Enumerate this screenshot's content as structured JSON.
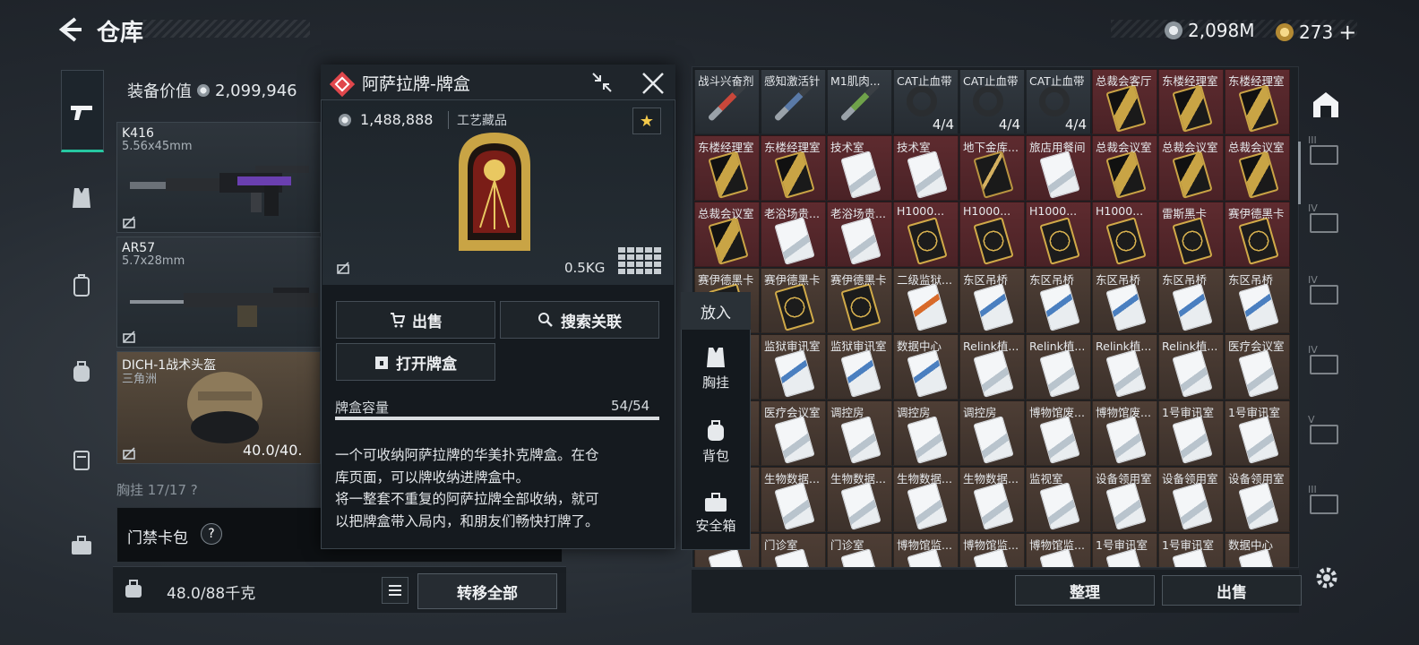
{
  "header": {
    "title": "仓库",
    "currency1": "2,098M",
    "currency2": "273",
    "plus": "+"
  },
  "equipment": {
    "value_label": "装备价值",
    "value": "2,099,946",
    "slots": [
      {
        "name": "K416",
        "sub": "5.56x45mm"
      },
      {
        "name": "AR57",
        "sub": "5.7x28mm"
      },
      {
        "name": "DICH-1战术头盔",
        "sub": "三角洲",
        "durability": "40.0/40."
      }
    ],
    "chest_row": "胸挂  17/17  ?",
    "card_bag": "门禁卡包",
    "card_bag_help": "?",
    "weight": "48.0/88千克",
    "transfer_all": "转移全部"
  },
  "popup": {
    "title": "阿萨拉牌-牌盒",
    "price": "1,488,888",
    "category": "工艺藏品",
    "favorite_icon": "★",
    "weight": "0.5KG",
    "sell": "出售",
    "search": "搜索关联",
    "open": "打开牌盒",
    "capacity_label": "牌盒容量",
    "capacity_value": "54/54",
    "capacity_fraction": 1.0,
    "desc_lines": [
      "一个可收纳阿萨拉牌的华美扑克牌盒。在仓",
      "库页面，可以牌收纳进牌盒中。",
      "将一整套不重复的阿萨拉牌全部收纳，就可",
      "以把牌盒带入局内，和朋友们畅快打牌了。"
    ]
  },
  "put_menu": {
    "header": "放入",
    "items": [
      {
        "label": "胸挂",
        "icon": "vest-icon"
      },
      {
        "label": "背包",
        "icon": "backpack-icon"
      },
      {
        "label": "安全箱",
        "icon": "safebox-icon"
      }
    ]
  },
  "grid": {
    "rows": [
      [
        {
          "l": "战斗兴奋剂",
          "t": "stim",
          "c": "#c9473a"
        },
        {
          "l": "感知激活针",
          "t": "stim",
          "c": "#5a7aa8"
        },
        {
          "l": "M1肌肉...",
          "t": "stim",
          "c": "#6fa24a"
        },
        {
          "l": "CAT止血带",
          "t": "tourn",
          "n": "4/4"
        },
        {
          "l": "CAT止血带",
          "t": "tourn",
          "n": "4/4"
        },
        {
          "l": "CAT止血带",
          "t": "tourn",
          "n": "4/4"
        },
        {
          "l": "总裁会客厅",
          "t": "gold",
          "bg": "red"
        },
        {
          "l": "东楼经理室",
          "t": "gold",
          "bg": "red"
        },
        {
          "l": "东楼经理室",
          "t": "gold",
          "bg": "red"
        }
      ],
      [
        {
          "l": "东楼经理室",
          "t": "gold",
          "bg": "red"
        },
        {
          "l": "东楼经理室",
          "t": "gold",
          "bg": "red"
        },
        {
          "l": "技术室",
          "t": "white",
          "bg": "red"
        },
        {
          "l": "技术室",
          "t": "white",
          "bg": "red"
        },
        {
          "l": "地下金库...",
          "t": "black",
          "bg": "red"
        },
        {
          "l": "旅店用餐间",
          "t": "white",
          "bg": "red"
        },
        {
          "l": "总裁会议室",
          "t": "gold",
          "bg": "red"
        },
        {
          "l": "总裁会议室",
          "t": "gold",
          "bg": "red"
        },
        {
          "l": "总裁会议室",
          "t": "gold",
          "bg": "red"
        }
      ],
      [
        {
          "l": "总裁会议室",
          "t": "gold",
          "bg": "red"
        },
        {
          "l": "老浴场贵...",
          "t": "white",
          "bg": "red"
        },
        {
          "l": "老浴场贵...",
          "t": "white",
          "bg": "red"
        },
        {
          "l": "H1000...",
          "t": "medal",
          "bg": "red"
        },
        {
          "l": "H1000...",
          "t": "medal",
          "bg": "red"
        },
        {
          "l": "H1000...",
          "t": "medal",
          "bg": "red"
        },
        {
          "l": "H1000...",
          "t": "medal",
          "bg": "red"
        },
        {
          "l": "雷斯黑卡",
          "t": "medal",
          "bg": "red"
        },
        {
          "l": "赛伊德黑卡",
          "t": "medal",
          "bg": "red"
        }
      ],
      [
        {
          "l": "赛伊德黑卡",
          "t": "medal",
          "bg": "brown"
        },
        {
          "l": "赛伊德黑卡",
          "t": "medal",
          "bg": "brown"
        },
        {
          "l": "赛伊德黑卡",
          "t": "medal",
          "bg": "brown"
        },
        {
          "l": "二级监狱...",
          "t": "rust",
          "bg": "brown"
        },
        {
          "l": "东区吊桥",
          "t": "blue",
          "bg": "brown"
        },
        {
          "l": "东区吊桥",
          "t": "blue",
          "bg": "brown"
        },
        {
          "l": "东区吊桥",
          "t": "blue",
          "bg": "brown"
        },
        {
          "l": "东区吊桥",
          "t": "blue",
          "bg": "brown"
        },
        {
          "l": "东区吊桥",
          "t": "blue",
          "bg": "brown"
        }
      ],
      [
        {
          "l": "",
          "t": "white",
          "bg": "brown"
        },
        {
          "l": "监狱审讯室",
          "t": "blue",
          "bg": "brown"
        },
        {
          "l": "监狱审讯室",
          "t": "blue",
          "bg": "brown"
        },
        {
          "l": "数据中心",
          "t": "blue",
          "bg": "brown"
        },
        {
          "l": "Relink植...",
          "t": "white",
          "bg": "brown"
        },
        {
          "l": "Relink植...",
          "t": "white",
          "bg": "brown"
        },
        {
          "l": "Relink植...",
          "t": "white",
          "bg": "brown"
        },
        {
          "l": "Relink植...",
          "t": "white",
          "bg": "brown"
        },
        {
          "l": "医疗会议室",
          "t": "white",
          "bg": "brown"
        }
      ],
      [
        {
          "l": "",
          "t": "white",
          "bg": "brown"
        },
        {
          "l": "医疗会议室",
          "t": "white",
          "bg": "brown"
        },
        {
          "l": "调控房",
          "t": "white",
          "bg": "brown"
        },
        {
          "l": "调控房",
          "t": "white",
          "bg": "brown"
        },
        {
          "l": "调控房",
          "t": "white",
          "bg": "brown"
        },
        {
          "l": "博物馆废...",
          "t": "white",
          "bg": "brown"
        },
        {
          "l": "博物馆废...",
          "t": "white",
          "bg": "brown"
        },
        {
          "l": "1号审讯室",
          "t": "white",
          "bg": "brown"
        },
        {
          "l": "1号审讯室",
          "t": "white",
          "bg": "brown"
        }
      ],
      [
        {
          "l": "",
          "t": "white",
          "bg": "brown"
        },
        {
          "l": "生物数据...",
          "t": "white",
          "bg": "brown"
        },
        {
          "l": "生物数据...",
          "t": "white",
          "bg": "brown"
        },
        {
          "l": "生物数据...",
          "t": "white",
          "bg": "brown"
        },
        {
          "l": "生物数据...",
          "t": "white",
          "bg": "brown"
        },
        {
          "l": "监视室",
          "t": "white",
          "bg": "brown"
        },
        {
          "l": "设备领用室",
          "t": "white",
          "bg": "brown"
        },
        {
          "l": "设备领用室",
          "t": "white",
          "bg": "brown"
        },
        {
          "l": "设备领用室",
          "t": "white",
          "bg": "brown"
        }
      ],
      [
        {
          "l": "",
          "t": "white",
          "bg": "brown"
        },
        {
          "l": "门诊室",
          "t": "white",
          "bg": "brown"
        },
        {
          "l": "门诊室",
          "t": "white",
          "bg": "brown"
        },
        {
          "l": "博物馆监...",
          "t": "white",
          "bg": "brown"
        },
        {
          "l": "博物馆监...",
          "t": "white",
          "bg": "brown"
        },
        {
          "l": "博物馆监...",
          "t": "white",
          "bg": "brown"
        },
        {
          "l": "1号审讯室",
          "t": "white",
          "bg": "brown"
        },
        {
          "l": "1号审讯室",
          "t": "white",
          "bg": "brown"
        },
        {
          "l": "数据中心",
          "t": "white",
          "bg": "brown"
        }
      ]
    ],
    "organize": "整理",
    "sell": "出售"
  },
  "right_rail": [
    "III",
    "IV",
    "IV",
    "IV",
    "V",
    "III"
  ],
  "colors": {
    "accent": "#26c7a1",
    "red_cell": "#5a2a2e",
    "brown_cell": "#4a3b33",
    "diamond": "#e0474c"
  }
}
